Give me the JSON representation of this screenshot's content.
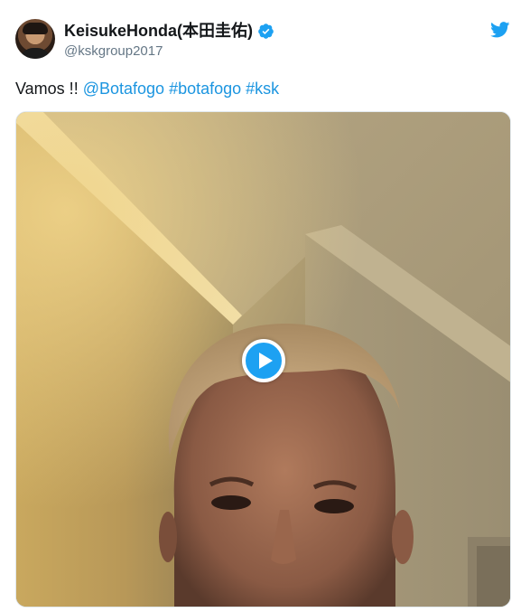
{
  "tweet": {
    "author": {
      "display_name": "KeisukeHonda(本田圭佑)",
      "handle": "@kskgroup2017",
      "verified": true,
      "avatar_icon": "profile-photo"
    },
    "text": {
      "plain": "Vamos !! ",
      "mention": "@Botafogo",
      "hashtag1": "#botafogo",
      "hashtag2": "#ksk"
    },
    "media": {
      "type": "video",
      "play_icon": "play-icon"
    },
    "brand_icon": "twitter-bird-icon",
    "colors": {
      "link": "#1b95e0",
      "brand": "#1da1f2",
      "name": "#14171a",
      "handle": "#657786"
    }
  }
}
